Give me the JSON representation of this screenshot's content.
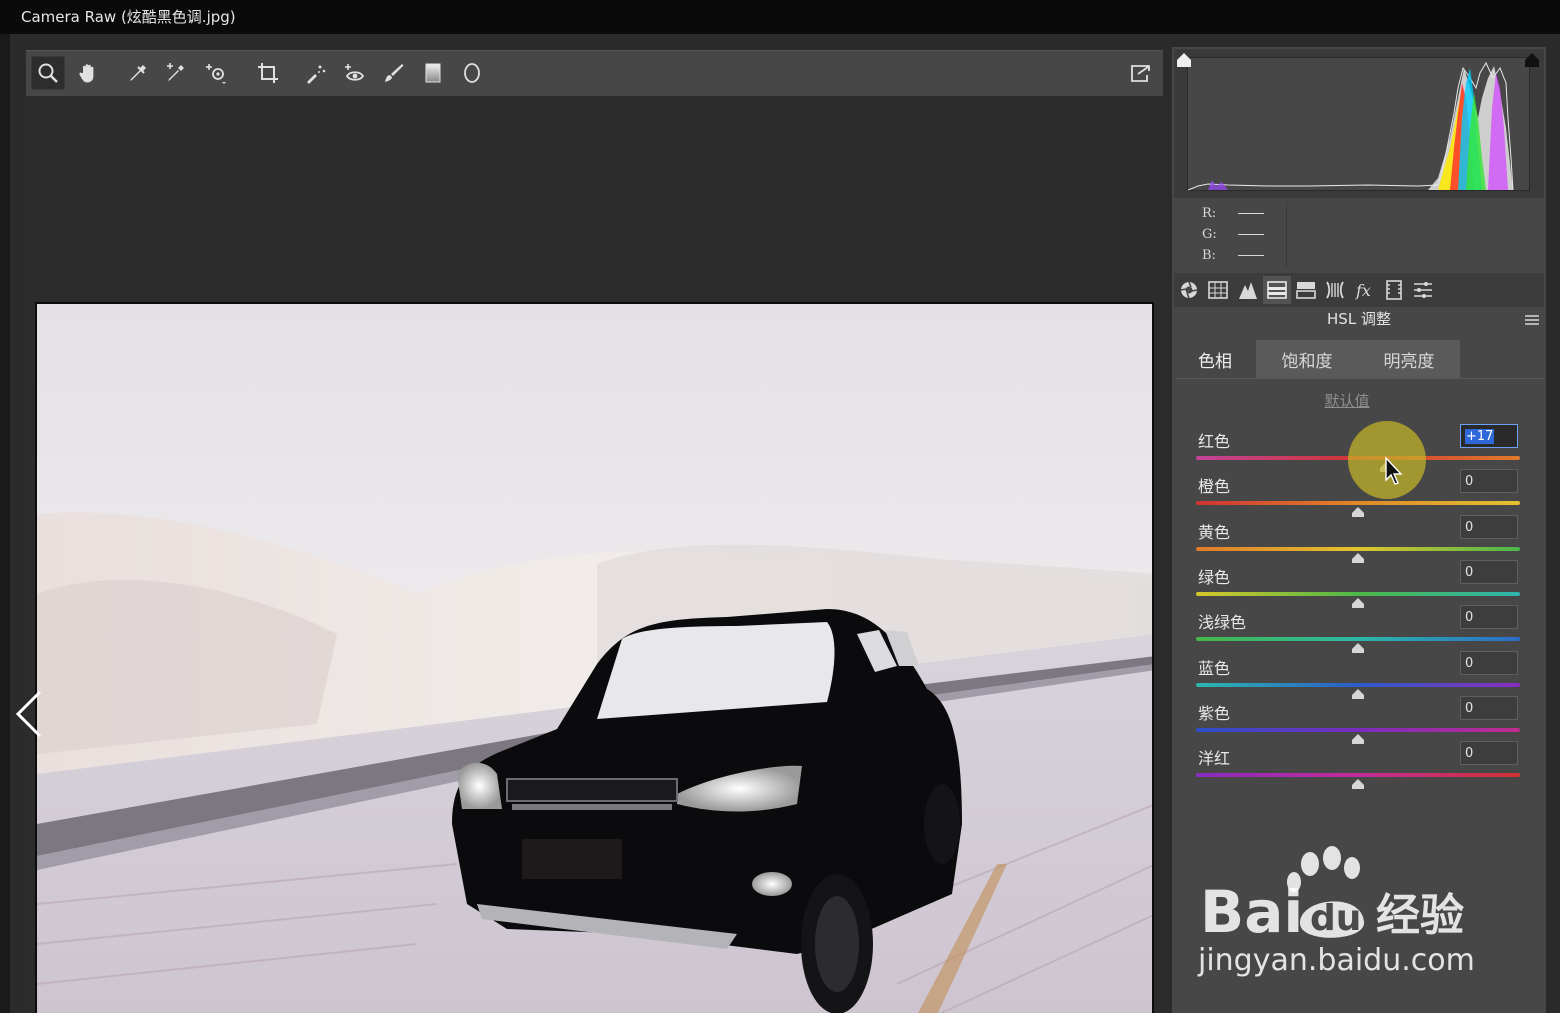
{
  "window": {
    "title": "Camera Raw (炫酷黑色调.jpg)"
  },
  "toolbar": {
    "tools": [
      {
        "icon": "zoom-icon",
        "active": true
      },
      {
        "icon": "hand-icon"
      },
      {
        "icon": "white-balance-eyedropper-icon"
      },
      {
        "icon": "color-sampler-icon"
      },
      {
        "icon": "targeted-adjustment-icon"
      },
      {
        "icon": "crop-icon"
      },
      {
        "icon": "spot-removal-icon"
      },
      {
        "icon": "red-eye-icon"
      },
      {
        "icon": "adjustment-brush-icon"
      },
      {
        "icon": "graduated-filter-icon"
      },
      {
        "icon": "radial-filter-icon"
      }
    ],
    "fullscreen_icon": "toggle-fullscreen-icon"
  },
  "readout": {
    "r_label": "R:",
    "g_label": "G:",
    "b_label": "B:"
  },
  "panel_tabs": [
    {
      "icon": "basic-icon"
    },
    {
      "icon": "tone-curve-icon"
    },
    {
      "icon": "detail-icon"
    },
    {
      "icon": "hsl-icon",
      "active": true
    },
    {
      "icon": "split-toning-icon"
    },
    {
      "icon": "lens-corrections-icon"
    },
    {
      "icon": "effects-icon"
    },
    {
      "icon": "camera-calibration-icon"
    },
    {
      "icon": "presets-icon"
    }
  ],
  "section": {
    "title": "HSL 调整"
  },
  "subtabs": [
    {
      "label": "色相",
      "active": true
    },
    {
      "label": "饱和度"
    },
    {
      "label": "明亮度"
    }
  ],
  "defaults_link": "默认值",
  "sliders": [
    {
      "label": "红色",
      "value": "+17",
      "level": 0.585,
      "focused": true,
      "gradient": [
        "#c2449a",
        "#d23434",
        "#e07a2a"
      ]
    },
    {
      "label": "橙色",
      "value": "0",
      "level": 0.5,
      "gradient": [
        "#d13232",
        "#e0882a",
        "#e4c22e"
      ]
    },
    {
      "label": "黄色",
      "value": "0",
      "level": 0.5,
      "gradient": [
        "#e07a2a",
        "#e2c52c",
        "#48b84a"
      ]
    },
    {
      "label": "绿色",
      "value": "0",
      "level": 0.5,
      "gradient": [
        "#d8c82a",
        "#4cb848",
        "#2fb6b0"
      ]
    },
    {
      "label": "浅绿色",
      "value": "0",
      "level": 0.5,
      "gradient": [
        "#46b848",
        "#2cb8a8",
        "#2c6cc8"
      ]
    },
    {
      "label": "蓝色",
      "value": "0",
      "level": 0.5,
      "gradient": [
        "#2cb8b0",
        "#2c5cc8",
        "#8a2cc0"
      ]
    },
    {
      "label": "紫色",
      "value": "0",
      "level": 0.5,
      "gradient": [
        "#2c50c8",
        "#7a2cc0",
        "#c22c8e"
      ]
    },
    {
      "label": "洋红",
      "value": "0",
      "level": 0.5,
      "gradient": [
        "#8a2cc0",
        "#c22c9a",
        "#d23232"
      ]
    }
  ],
  "watermark": {
    "brand": "Bai du 经验",
    "url": "jingyan.baidu.com"
  },
  "colors": {
    "panel": "#474747",
    "frame": "#2b2b2b",
    "accent_focus": "#2f68d8"
  }
}
